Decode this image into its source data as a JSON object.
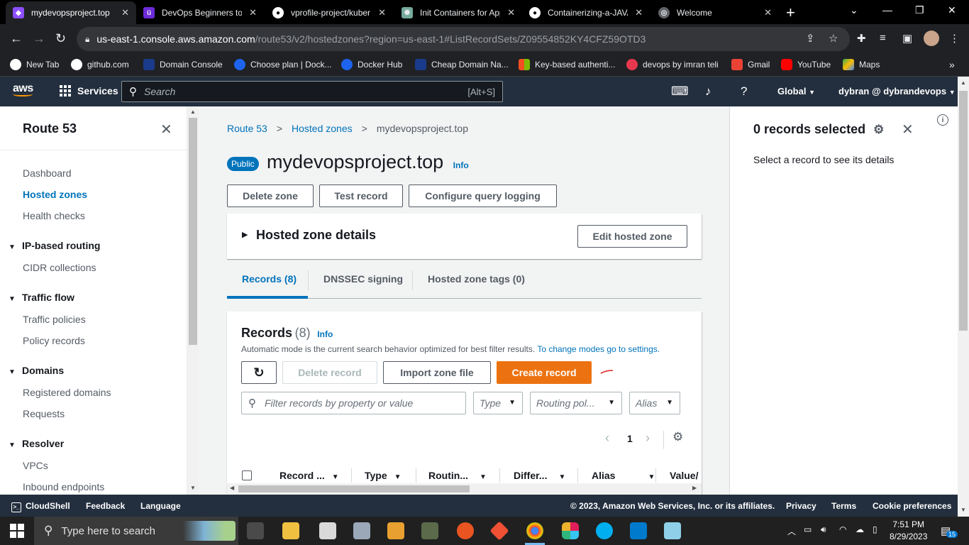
{
  "browser": {
    "tabs": [
      {
        "title": "mydevopsproject.top",
        "active": true
      },
      {
        "title": "DevOps Beginners to Advanced",
        "active": false
      },
      {
        "title": "vprofile-project/kuber",
        "active": false
      },
      {
        "title": "Init Containers for App",
        "active": false
      },
      {
        "title": "Containerizing-a-JAVA",
        "active": false
      },
      {
        "title": "Welcome",
        "active": false
      }
    ],
    "url_host": "us-east-1.console.aws.amazon.com",
    "url_path": "/route53/v2/hostedzones?region=us-east-1#ListRecordSets/Z09554852KY4CFZ59OTD3",
    "bookmarks": [
      "New Tab",
      "github.com",
      "Domain Console",
      "Choose plan | Dock...",
      "Docker Hub",
      "Cheap Domain Na...",
      "Key-based authenti...",
      "devops by imran teli",
      "Gmail",
      "YouTube",
      "Maps"
    ]
  },
  "aws_header": {
    "logo": "aws",
    "services_label": "Services",
    "search_placeholder": "Search",
    "search_hint": "[Alt+S]",
    "region_label": "Global",
    "account_label": "dybran @ dybrandevops"
  },
  "sidenav": {
    "title": "Route 53",
    "links_top": [
      "Dashboard",
      "Hosted zones",
      "Health checks"
    ],
    "sections": [
      {
        "label": "IP-based routing",
        "items": [
          "CIDR collections"
        ]
      },
      {
        "label": "Traffic flow",
        "items": [
          "Traffic policies",
          "Policy records"
        ]
      },
      {
        "label": "Domains",
        "items": [
          "Registered domains",
          "Requests"
        ]
      },
      {
        "label": "Resolver",
        "items": [
          "VPCs",
          "Inbound endpoints"
        ]
      }
    ]
  },
  "main": {
    "breadcrumb": [
      "Route 53",
      "Hosted zones",
      "mydevopsproject.top"
    ],
    "badge": "Public",
    "zone_name": "mydevopsproject.top",
    "info_label": "Info",
    "actions": [
      "Delete zone",
      "Test record",
      "Configure query logging"
    ],
    "details_title": "Hosted zone details",
    "edit_button": "Edit hosted zone",
    "tabs": [
      "Records (8)",
      "DNSSEC signing",
      "Hosted zone tags (0)"
    ],
    "records": {
      "title": "Records",
      "count": "(8)",
      "description": "Automatic mode is the current search behavior optimized for best filter results.",
      "settings_link": "To change modes go to settings.",
      "delete_button": "Delete record",
      "import_button": "Import zone file",
      "create_button": "Create record",
      "filter_placeholder": "Filter records by property or value",
      "type_filter": "Type",
      "routing_filter": "Routing pol...",
      "alias_filter": "Alias",
      "page_number": "1",
      "columns": [
        "Record ...",
        "Type",
        "Routin...",
        "Differ...",
        "Alias",
        "Value/"
      ]
    }
  },
  "split_panel": {
    "title": "0 records selected",
    "message": "Select a record to see its details"
  },
  "aws_footer": {
    "left": [
      "CloudShell",
      "Feedback",
      "Language"
    ],
    "copyright": "© 2023, Amazon Web Services, Inc. or its affiliates.",
    "right": [
      "Privacy",
      "Terms",
      "Cookie preferences"
    ]
  },
  "taskbar": {
    "search_placeholder": "Type here to search",
    "time": "7:51 PM",
    "date": "8/29/2023",
    "notification_count": "15"
  },
  "colors": {
    "aws_navy": "#232f3e",
    "aws_orange": "#ec7211",
    "link_blue": "#0073bb"
  }
}
